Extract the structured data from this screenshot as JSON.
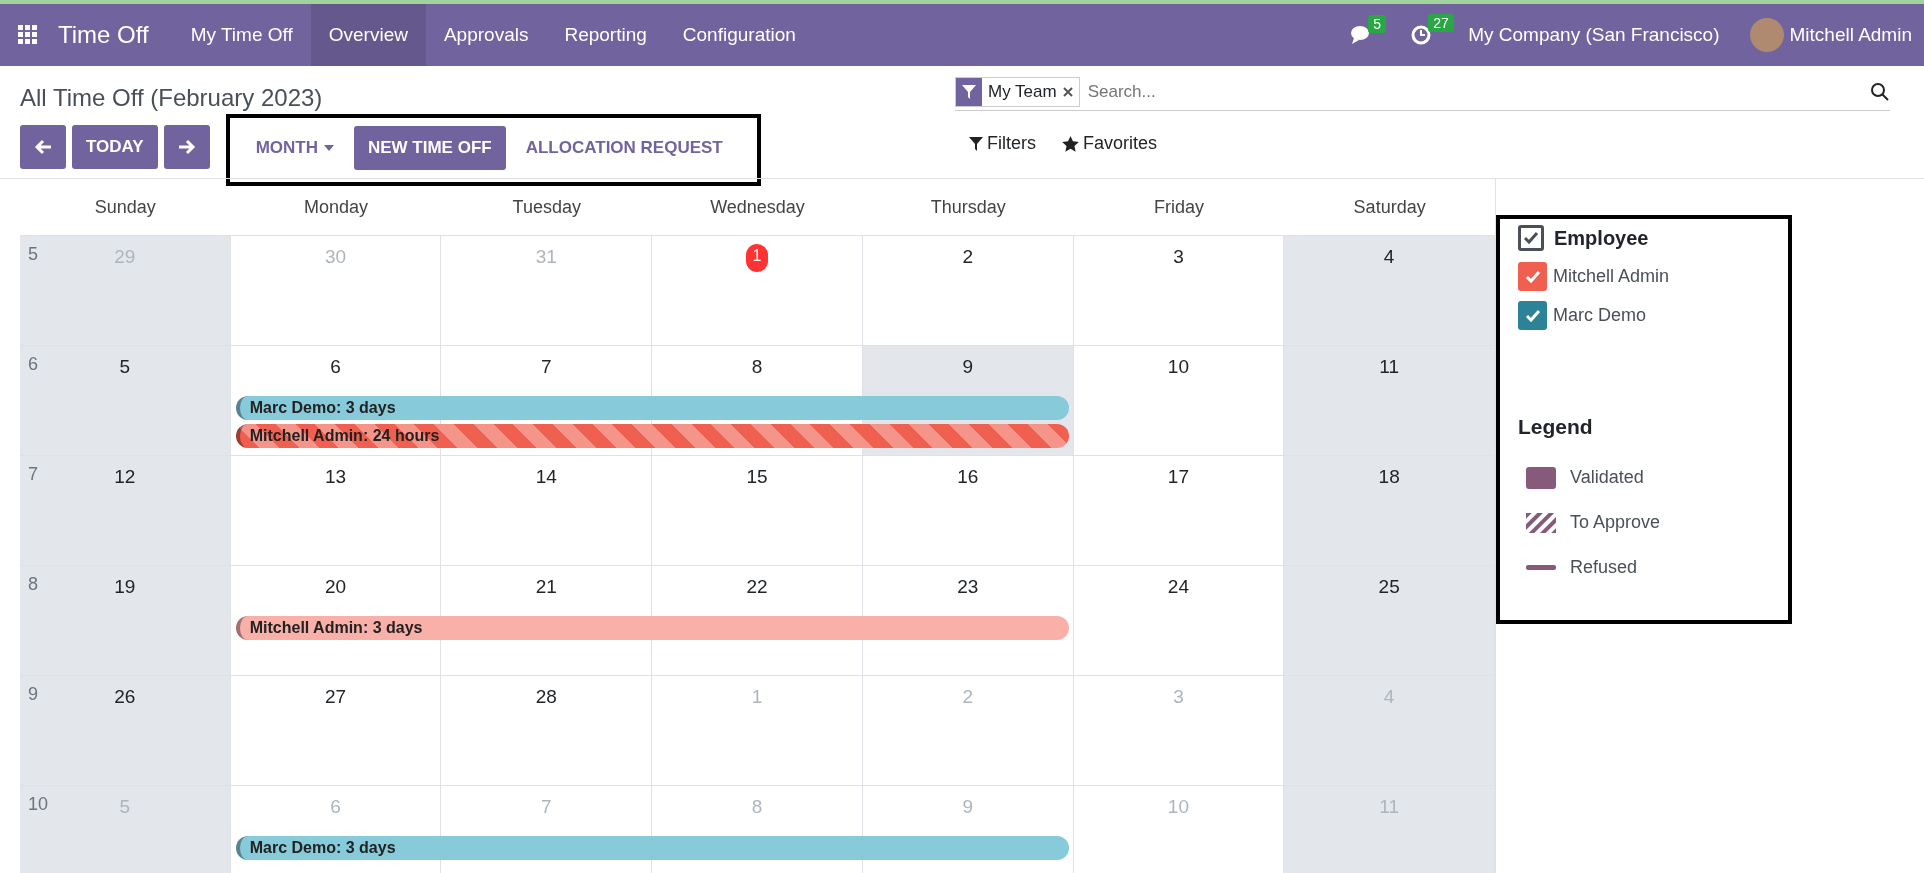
{
  "navbar": {
    "app_name": "Time Off",
    "menu": [
      {
        "label": "My Time Off",
        "selected": false
      },
      {
        "label": "Overview",
        "selected": true
      },
      {
        "label": "Approvals",
        "selected": false
      },
      {
        "label": "Reporting",
        "selected": false
      },
      {
        "label": "Configuration",
        "selected": false
      }
    ],
    "messages_count": "5",
    "activities_count": "27",
    "company": "My Company (San Francisco)",
    "user": "Mitchell Admin"
  },
  "page_title": "All Time Off (February 2023)",
  "toolbar": {
    "today": "TODAY",
    "scale": "MONTH",
    "new_button": "NEW TIME OFF",
    "allocation_button": "ALLOCATION REQUEST"
  },
  "search": {
    "facet": "My Team",
    "placeholder": "Search...",
    "filters": "Filters",
    "favorites": "Favorites"
  },
  "calendar": {
    "weekdays": [
      "Sunday",
      "Monday",
      "Tuesday",
      "Wednesday",
      "Thursday",
      "Friday",
      "Saturday"
    ],
    "weeks": [
      {
        "number": "5",
        "days": [
          {
            "label": "29",
            "other_month": true,
            "today": false,
            "shaded": true
          },
          {
            "label": "30",
            "other_month": true,
            "today": false,
            "shaded": false
          },
          {
            "label": "31",
            "other_month": true,
            "today": false,
            "shaded": false
          },
          {
            "label": "1",
            "other_month": false,
            "today": true,
            "shaded": false
          },
          {
            "label": "2",
            "other_month": false,
            "today": false,
            "shaded": false
          },
          {
            "label": "3",
            "other_month": false,
            "today": false,
            "shaded": false
          },
          {
            "label": "4",
            "other_month": false,
            "today": false,
            "shaded": true
          }
        ]
      },
      {
        "number": "6",
        "days": [
          {
            "label": "5",
            "other_month": false,
            "today": false,
            "shaded": true
          },
          {
            "label": "6",
            "other_month": false,
            "today": false,
            "shaded": false
          },
          {
            "label": "7",
            "other_month": false,
            "today": false,
            "shaded": false
          },
          {
            "label": "8",
            "other_month": false,
            "today": false,
            "shaded": false
          },
          {
            "label": "9",
            "other_month": false,
            "today": false,
            "shaded": true
          },
          {
            "label": "10",
            "other_month": false,
            "today": false,
            "shaded": false
          },
          {
            "label": "11",
            "other_month": false,
            "today": false,
            "shaded": true
          }
        ],
        "events": [
          {
            "label": "Marc Demo: 3 days",
            "color": "#87cad9",
            "striped": false
          },
          {
            "label": "Mitchell Admin: 24 hours",
            "color": "#f06050",
            "striped": true
          }
        ]
      },
      {
        "number": "7",
        "days": [
          {
            "label": "12",
            "other_month": false,
            "today": false,
            "shaded": true
          },
          {
            "label": "13",
            "other_month": false,
            "today": false,
            "shaded": false
          },
          {
            "label": "14",
            "other_month": false,
            "today": false,
            "shaded": false
          },
          {
            "label": "15",
            "other_month": false,
            "today": false,
            "shaded": false
          },
          {
            "label": "16",
            "other_month": false,
            "today": false,
            "shaded": false
          },
          {
            "label": "17",
            "other_month": false,
            "today": false,
            "shaded": false
          },
          {
            "label": "18",
            "other_month": false,
            "today": false,
            "shaded": true
          }
        ]
      },
      {
        "number": "8",
        "days": [
          {
            "label": "19",
            "other_month": false,
            "today": false,
            "shaded": true
          },
          {
            "label": "20",
            "other_month": false,
            "today": false,
            "shaded": false
          },
          {
            "label": "21",
            "other_month": false,
            "today": false,
            "shaded": false
          },
          {
            "label": "22",
            "other_month": false,
            "today": false,
            "shaded": false
          },
          {
            "label": "23",
            "other_month": false,
            "today": false,
            "shaded": false
          },
          {
            "label": "24",
            "other_month": false,
            "today": false,
            "shaded": false
          },
          {
            "label": "25",
            "other_month": false,
            "today": false,
            "shaded": true
          }
        ],
        "events": [
          {
            "label": "Mitchell Admin: 3 days",
            "color": "#f8b0a8",
            "striped": false
          }
        ]
      },
      {
        "number": "9",
        "days": [
          {
            "label": "26",
            "other_month": false,
            "today": false,
            "shaded": true
          },
          {
            "label": "27",
            "other_month": false,
            "today": false,
            "shaded": false
          },
          {
            "label": "28",
            "other_month": false,
            "today": false,
            "shaded": false
          },
          {
            "label": "1",
            "other_month": true,
            "today": false,
            "shaded": false
          },
          {
            "label": "2",
            "other_month": true,
            "today": false,
            "shaded": false
          },
          {
            "label": "3",
            "other_month": true,
            "today": false,
            "shaded": false
          },
          {
            "label": "4",
            "other_month": true,
            "today": false,
            "shaded": true
          }
        ]
      },
      {
        "number": "10",
        "days": [
          {
            "label": "5",
            "other_month": true,
            "today": false,
            "shaded": true
          },
          {
            "label": "6",
            "other_month": true,
            "today": false,
            "shaded": false
          },
          {
            "label": "7",
            "other_month": true,
            "today": false,
            "shaded": false
          },
          {
            "label": "8",
            "other_month": true,
            "today": false,
            "shaded": false
          },
          {
            "label": "9",
            "other_month": true,
            "today": false,
            "shaded": false
          },
          {
            "label": "10",
            "other_month": true,
            "today": false,
            "shaded": false
          },
          {
            "label": "11",
            "other_month": true,
            "today": false,
            "shaded": true
          }
        ],
        "events": [
          {
            "label": "Marc Demo: 3 days",
            "color": "#87cad9",
            "striped": false
          }
        ]
      }
    ]
  },
  "sidebar": {
    "filter_title": "Employee",
    "filter_checked": true,
    "employees": [
      {
        "name": "Mitchell Admin",
        "checked": true,
        "color": "#f06050"
      },
      {
        "name": "Marc Demo",
        "checked": true,
        "color": "#2c8397"
      }
    ],
    "legend_title": "Legend",
    "legend": [
      {
        "label": "Validated",
        "kind": "solid"
      },
      {
        "label": "To Approve",
        "kind": "striped"
      },
      {
        "label": "Refused",
        "kind": "line"
      }
    ]
  }
}
